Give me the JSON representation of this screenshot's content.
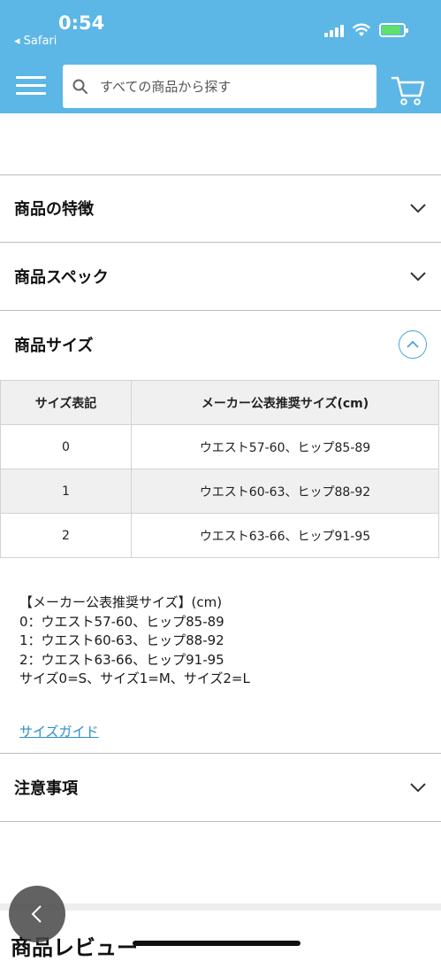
{
  "status_bar": {
    "time": "0:54",
    "back_app": "◂ Safari"
  },
  "header": {
    "search_placeholder": "すべての商品から探す",
    "brand_color": "#5cb6e6"
  },
  "accordion": {
    "features": "商品の特徴",
    "specs": "商品スペック",
    "size": "商品サイズ",
    "notes": "注意事項"
  },
  "size_table": {
    "headers": [
      "サイズ表記",
      "メーカー公表推奨サイズ(cm)"
    ],
    "rows": [
      [
        "0",
        "ウエスト57-60、ヒップ85-89"
      ],
      [
        "1",
        "ウエスト60-63、ヒップ88-92"
      ],
      [
        "2",
        "ウエスト63-66、ヒップ91-95"
      ]
    ]
  },
  "size_notes": [
    "【メーカー公表推奨サイズ】(cm)",
    "0：ウエスト57-60、ヒップ85-89",
    "1：ウエスト60-63、ヒップ88-92",
    "2：ウエスト63-66、ヒップ91-95",
    "サイズ0=S、サイズ1=M、サイズ2=L"
  ],
  "size_guide_link": "サイズガイド",
  "review_section_title": "商品レビュー"
}
